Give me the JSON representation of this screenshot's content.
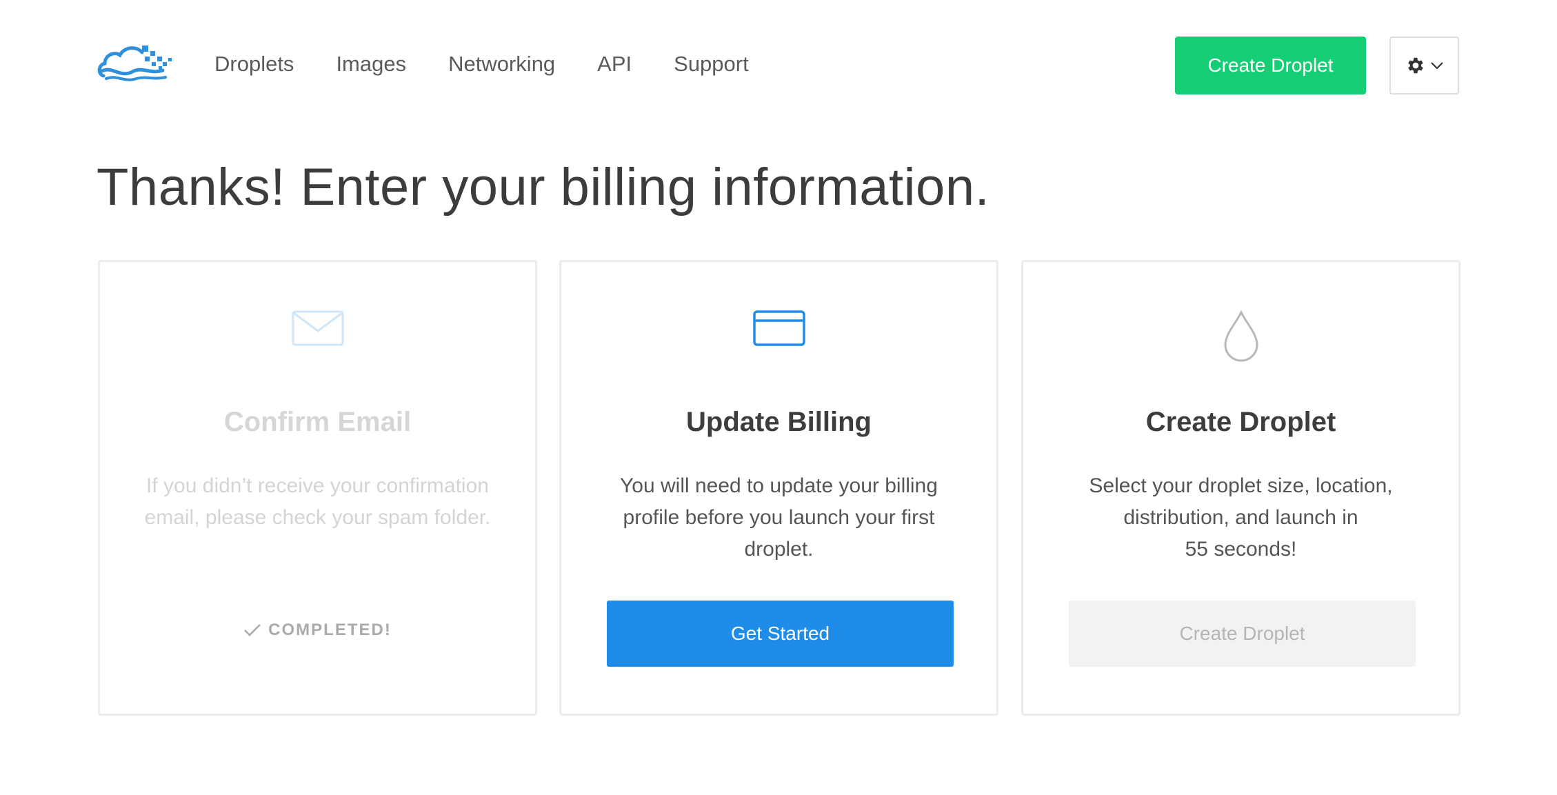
{
  "nav": {
    "items": [
      {
        "label": "Droplets"
      },
      {
        "label": "Images"
      },
      {
        "label": "Networking"
      },
      {
        "label": "API"
      },
      {
        "label": "Support"
      }
    ],
    "create_button": "Create Droplet",
    "settings_icon": "gear-icon",
    "settings_caret_icon": "chevron-down-icon"
  },
  "page": {
    "title": "Thanks! Enter your billing information."
  },
  "cards": [
    {
      "icon": "envelope-icon",
      "title": "Confirm Email",
      "description": "If you didn’t receive your confirmation email, please check your spam folder.",
      "status": "COMPLETED!",
      "status_icon": "checkmark-icon"
    },
    {
      "icon": "credit-card-icon",
      "title": "Update Billing",
      "description": "You will need to update your billing profile before you launch your first droplet.",
      "button": "Get Started"
    },
    {
      "icon": "droplet-icon",
      "title": "Create Droplet",
      "description_lines": [
        "Select your droplet size, location,",
        "distribution, and launch in",
        "55 seconds!"
      ],
      "button": "Create Droplet",
      "button_disabled": true
    }
  ],
  "colors": {
    "brand_blue": "#208ce9",
    "create_green": "#15cd72",
    "logo_blue": "#2f8fd8"
  }
}
